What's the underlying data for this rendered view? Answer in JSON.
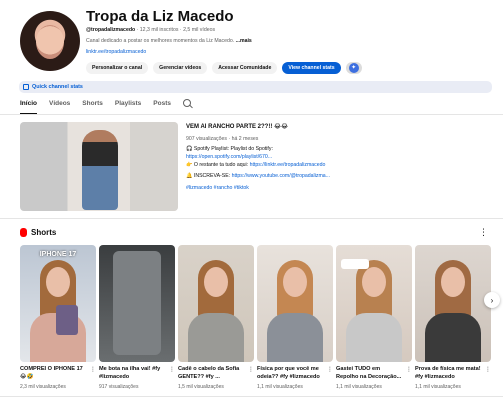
{
  "channel": {
    "title": "Tropa da Liz Macedo",
    "handle": "@tropadalizmacedo",
    "subscribers": "12,3 mil inscritos",
    "videos": "2,5 mil vídeos",
    "description": "Canal dedicado a postar os melhores momentos da Liz Macedo.",
    "more_label": "...mais",
    "link": "linktr.ee/tropadalizmacedo"
  },
  "buttons": {
    "customize": "Personalizar o canal",
    "manage": "Gerenciar vídeos",
    "community": "Acessar Comunidade",
    "stats": "View channel stats"
  },
  "quick_stats": "Quick channel stats",
  "tabs": [
    "Início",
    "Vídeos",
    "Shorts",
    "Playlists",
    "Posts"
  ],
  "featured": {
    "title": "VEM AI RANCHO PARTE 2??!! 😂😂",
    "views": "907 visualizações",
    "age": "há 2 meses",
    "line1": "🎧 Spotify Playlist: Playlist do Spotify:",
    "link1": "https://open.spotify.com/playlist/670...",
    "line2_prefix": "👉 O restante ta tudo aqui: ",
    "link2": "https://linktr.ee/tropadalizmacedo",
    "line3_prefix": "🔔 INSCREVA-SE: ",
    "link3": "https://www.youtube.com/@tropadalizma...",
    "hashtags": "#lizmacedo #rancho #tiktok"
  },
  "shorts": {
    "heading": "Shorts",
    "items": [
      {
        "title": "COMPREI O IPHONE 17 😂🤣",
        "views": "2,3 mil visualizações",
        "overlay": "IPHONE 17"
      },
      {
        "title": "Me bota na ilha vai! #fy #lizmacedo",
        "views": "917 visualizações"
      },
      {
        "title": "Cadê o cabelo da Sofia GENTE?? #fy ...",
        "views": "1,5 mil visualizações"
      },
      {
        "title": "Física por que você me odeia?? #fy #lizmacedo",
        "views": "1,1 mil visualizações"
      },
      {
        "title": "Gastei TUDO em Repolho na Decoração...",
        "views": "1,1 mil visualizações"
      },
      {
        "title": "Prova de física me mata! #fy #lizmacedo",
        "views": "1,1 mil visualizações"
      }
    ]
  }
}
